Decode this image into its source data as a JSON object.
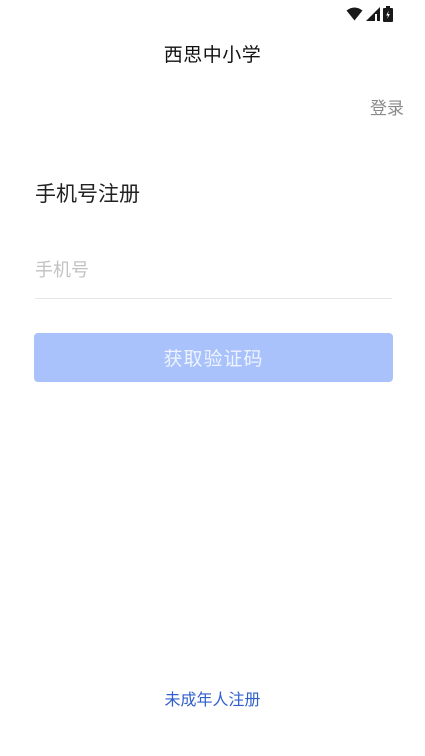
{
  "status_bar": {
    "icons": [
      "wifi-icon",
      "signal-icon",
      "battery-icon"
    ]
  },
  "header": {
    "title": "西思中小学"
  },
  "top_right": {
    "login_label": "登录"
  },
  "form": {
    "title": "手机号注册",
    "phone_placeholder": "手机号",
    "phone_value": "",
    "get_code_label": "获取验证码"
  },
  "footer": {
    "minor_register_label": "未成年人注册"
  },
  "colors": {
    "primary_disabled": "#a9c2fc",
    "link_blue": "#2f5fcc",
    "muted_text": "#8a8a8a",
    "placeholder": "#c2c2c2"
  }
}
